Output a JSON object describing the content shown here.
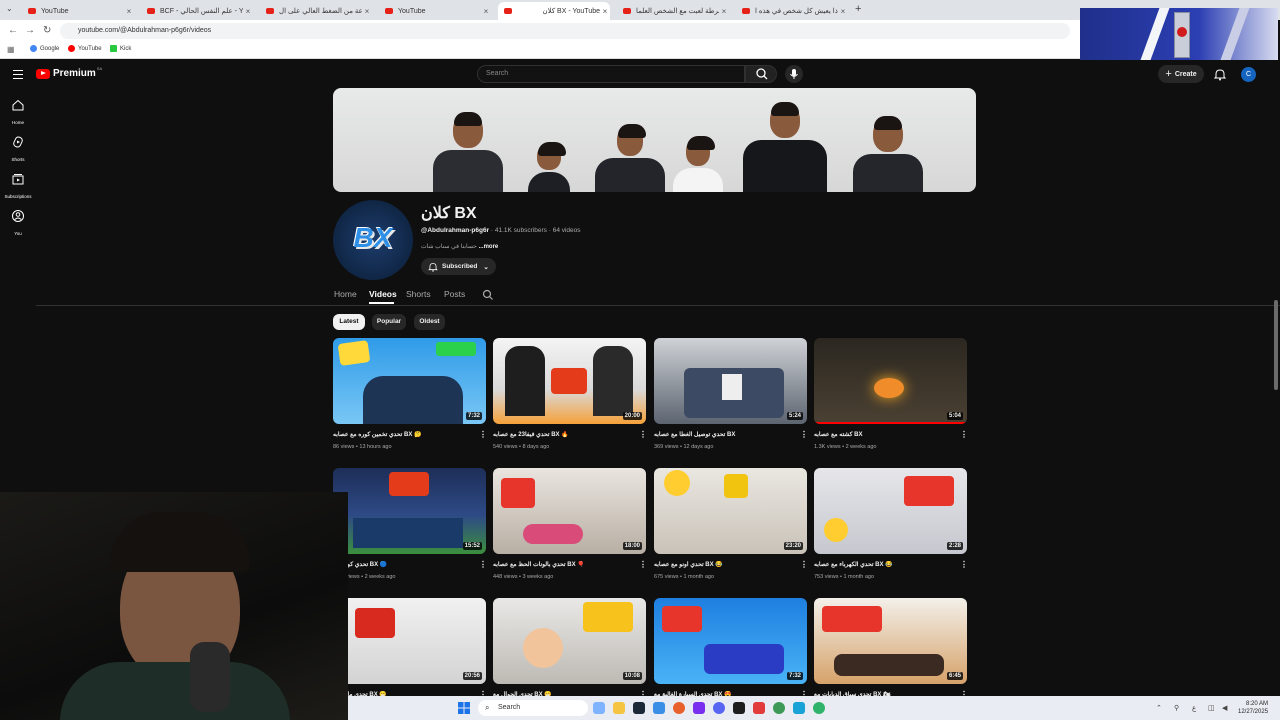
{
  "browser": {
    "tabs": [
      {
        "label": "YouTube",
        "active": false
      },
      {
        "label": "BCF - علم النفس الحالي - You...",
        "active": false
      },
      {
        "label": "ساعة من الضغط العالي على ال...",
        "active": false
      },
      {
        "label": "YouTube",
        "active": false
      },
      {
        "label": "كلان BX - YouTube",
        "active": true
      },
      {
        "label": "الشرطة لعبت مع الشخص العلما...",
        "active": false
      },
      {
        "label": "لماذا يعيش كل شخص في هذه ا...",
        "active": false
      }
    ],
    "new_tab_symbol": "+",
    "url": "youtube.com/@Abdulrahman-p6g6r/videos",
    "bookmarks": [
      {
        "label": "Google",
        "color": "#4285f4"
      },
      {
        "label": "YouTube",
        "color": "#ff0000"
      },
      {
        "label": "Kick",
        "color": "#27c93f"
      }
    ]
  },
  "youtube": {
    "logo_text": "Premium",
    "logo_region": "SA",
    "search_placeholder": "Search",
    "create_label": "Create",
    "avatar_letter": "C",
    "sidebar": [
      {
        "label": "Home",
        "icon": "home-icon"
      },
      {
        "label": "Shorts",
        "icon": "shorts-icon"
      },
      {
        "label": "Subscriptions",
        "icon": "subscriptions-icon"
      },
      {
        "label": "You",
        "icon": "you-icon"
      }
    ],
    "channel": {
      "name": "كلان BX",
      "handle": "@Abdulrahman-p6g6r",
      "subscribers": "41.1K subscribers",
      "videos_count": "64 videos",
      "description": "حسابنا في سناب شات",
      "more": "...more",
      "subscribed_label": "Subscribed",
      "avatar_text": "BX"
    },
    "channel_tabs": [
      "Home",
      "Videos",
      "Shorts",
      "Posts"
    ],
    "active_tab": "Videos",
    "chips": [
      "Latest",
      "Popular",
      "Oldest"
    ],
    "active_chip": "Latest",
    "videos": [
      {
        "title": "تحدي تخمين كوره مع عصابه BX 🤔",
        "views": "86 views",
        "age": "13 hours ago",
        "duration": "7:32"
      },
      {
        "title": "تحدي فيفا23 مع عصابه BX 🔥",
        "views": "540 views",
        "age": "8 days ago",
        "duration": "20:00"
      },
      {
        "title": "تحدي توصيل الغطا مع عصابه BX",
        "views": "369 views",
        "age": "12 days ago",
        "duration": "5:24"
      },
      {
        "title": "كشته مع عصابه BX",
        "views": "1.3K views",
        "age": "2 weeks ago",
        "duration": "5:04"
      },
      {
        "title": "تحدي كورة مع BX 🔵",
        "views": "1.1K views",
        "age": "2 weeks ago",
        "duration": "15:52"
      },
      {
        "title": "تحدي بالونات الحظ مع عصابه BX 🎈",
        "views": "448 views",
        "age": "3 weeks ago",
        "duration": "18:00"
      },
      {
        "title": "تحدي اونو مع عصابه BX 😂",
        "views": "675 views",
        "age": "1 month ago",
        "duration": "23:20"
      },
      {
        "title": "تحدي الكهرباء مع عصابه BX 😂",
        "views": "753 views",
        "age": "1 month ago",
        "duration": "2:28"
      },
      {
        "title": "تحدي مافيا مع BX 😁",
        "views": "",
        "age": "",
        "duration": "20:56"
      },
      {
        "title": "تحدي الجوال مع BX 😁",
        "views": "",
        "age": "",
        "duration": "10:08"
      },
      {
        "title": "تحدي السيارة الغالية مع BX 😍",
        "views": "",
        "age": "",
        "duration": "7:32"
      },
      {
        "title": "تحدي سباق الدبابات مع BX 🏍",
        "views": "",
        "age": "",
        "duration": "6:45"
      }
    ]
  },
  "taskbar": {
    "search_placeholder": "Search",
    "time": "8:20 AM",
    "date": "12/27/2025"
  }
}
